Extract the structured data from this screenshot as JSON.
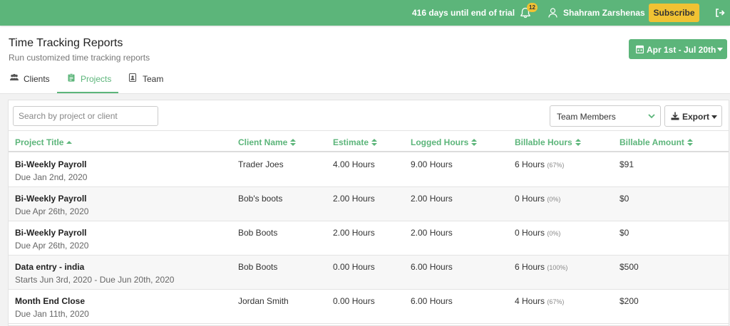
{
  "topbar": {
    "trial_text": "416 days until end of trial",
    "notification_count": "12",
    "user_name": "Shahram Zarshenas",
    "subscribe_label": "Subscribe",
    "brand_color": "#5cb57a",
    "accent_color": "#f0c233"
  },
  "header": {
    "title": "Time Tracking Reports",
    "subtitle": "Run customized time tracking reports",
    "date_range": "Apr 1st - Jul 20th"
  },
  "tabs": [
    {
      "label": "Clients",
      "icon": "users-icon"
    },
    {
      "label": "Projects",
      "icon": "clipboard-icon",
      "active": true
    },
    {
      "label": "Team",
      "icon": "id-badge-icon"
    }
  ],
  "controls": {
    "search_placeholder": "Search by project or client",
    "members_label": "Team Members",
    "export_label": "Export"
  },
  "table": {
    "columns": [
      "Project Title",
      "Client Name",
      "Estimate",
      "Logged Hours",
      "Billable Hours",
      "Billable Amount"
    ],
    "rows": [
      {
        "title": "Bi-Weekly Payroll",
        "due": "Due Jan 2nd, 2020",
        "client": "Trader Joes",
        "estimate": "4.00 Hours",
        "logged": "9.00 Hours",
        "billable": "6 Hours",
        "billable_pct": "(67%)",
        "amount": "$91"
      },
      {
        "title": "Bi-Weekly Payroll",
        "due": "Due Apr 26th, 2020",
        "client": "Bob's boots",
        "estimate": "2.00 Hours",
        "logged": "2.00 Hours",
        "billable": "0 Hours",
        "billable_pct": "(0%)",
        "amount": "$0"
      },
      {
        "title": "Bi-Weekly Payroll",
        "due": "Due Apr 26th, 2020",
        "client": "Bob Boots",
        "estimate": "2.00 Hours",
        "logged": "2.00 Hours",
        "billable": "0 Hours",
        "billable_pct": "(0%)",
        "amount": "$0"
      },
      {
        "title": "Data entry - india",
        "due": "Starts Jun 3rd, 2020 - Due Jun 20th, 2020",
        "client": "Bob Boots",
        "estimate": "0.00 Hours",
        "logged": "6.00 Hours",
        "billable": "6 Hours",
        "billable_pct": "(100%)",
        "amount": "$500"
      },
      {
        "title": "Month End Close",
        "due": "Due Jan 11th, 2020",
        "client": "Jordan Smith",
        "estimate": "0.00 Hours",
        "logged": "6.00 Hours",
        "billable": "4 Hours",
        "billable_pct": "(67%)",
        "amount": "$200"
      }
    ]
  }
}
